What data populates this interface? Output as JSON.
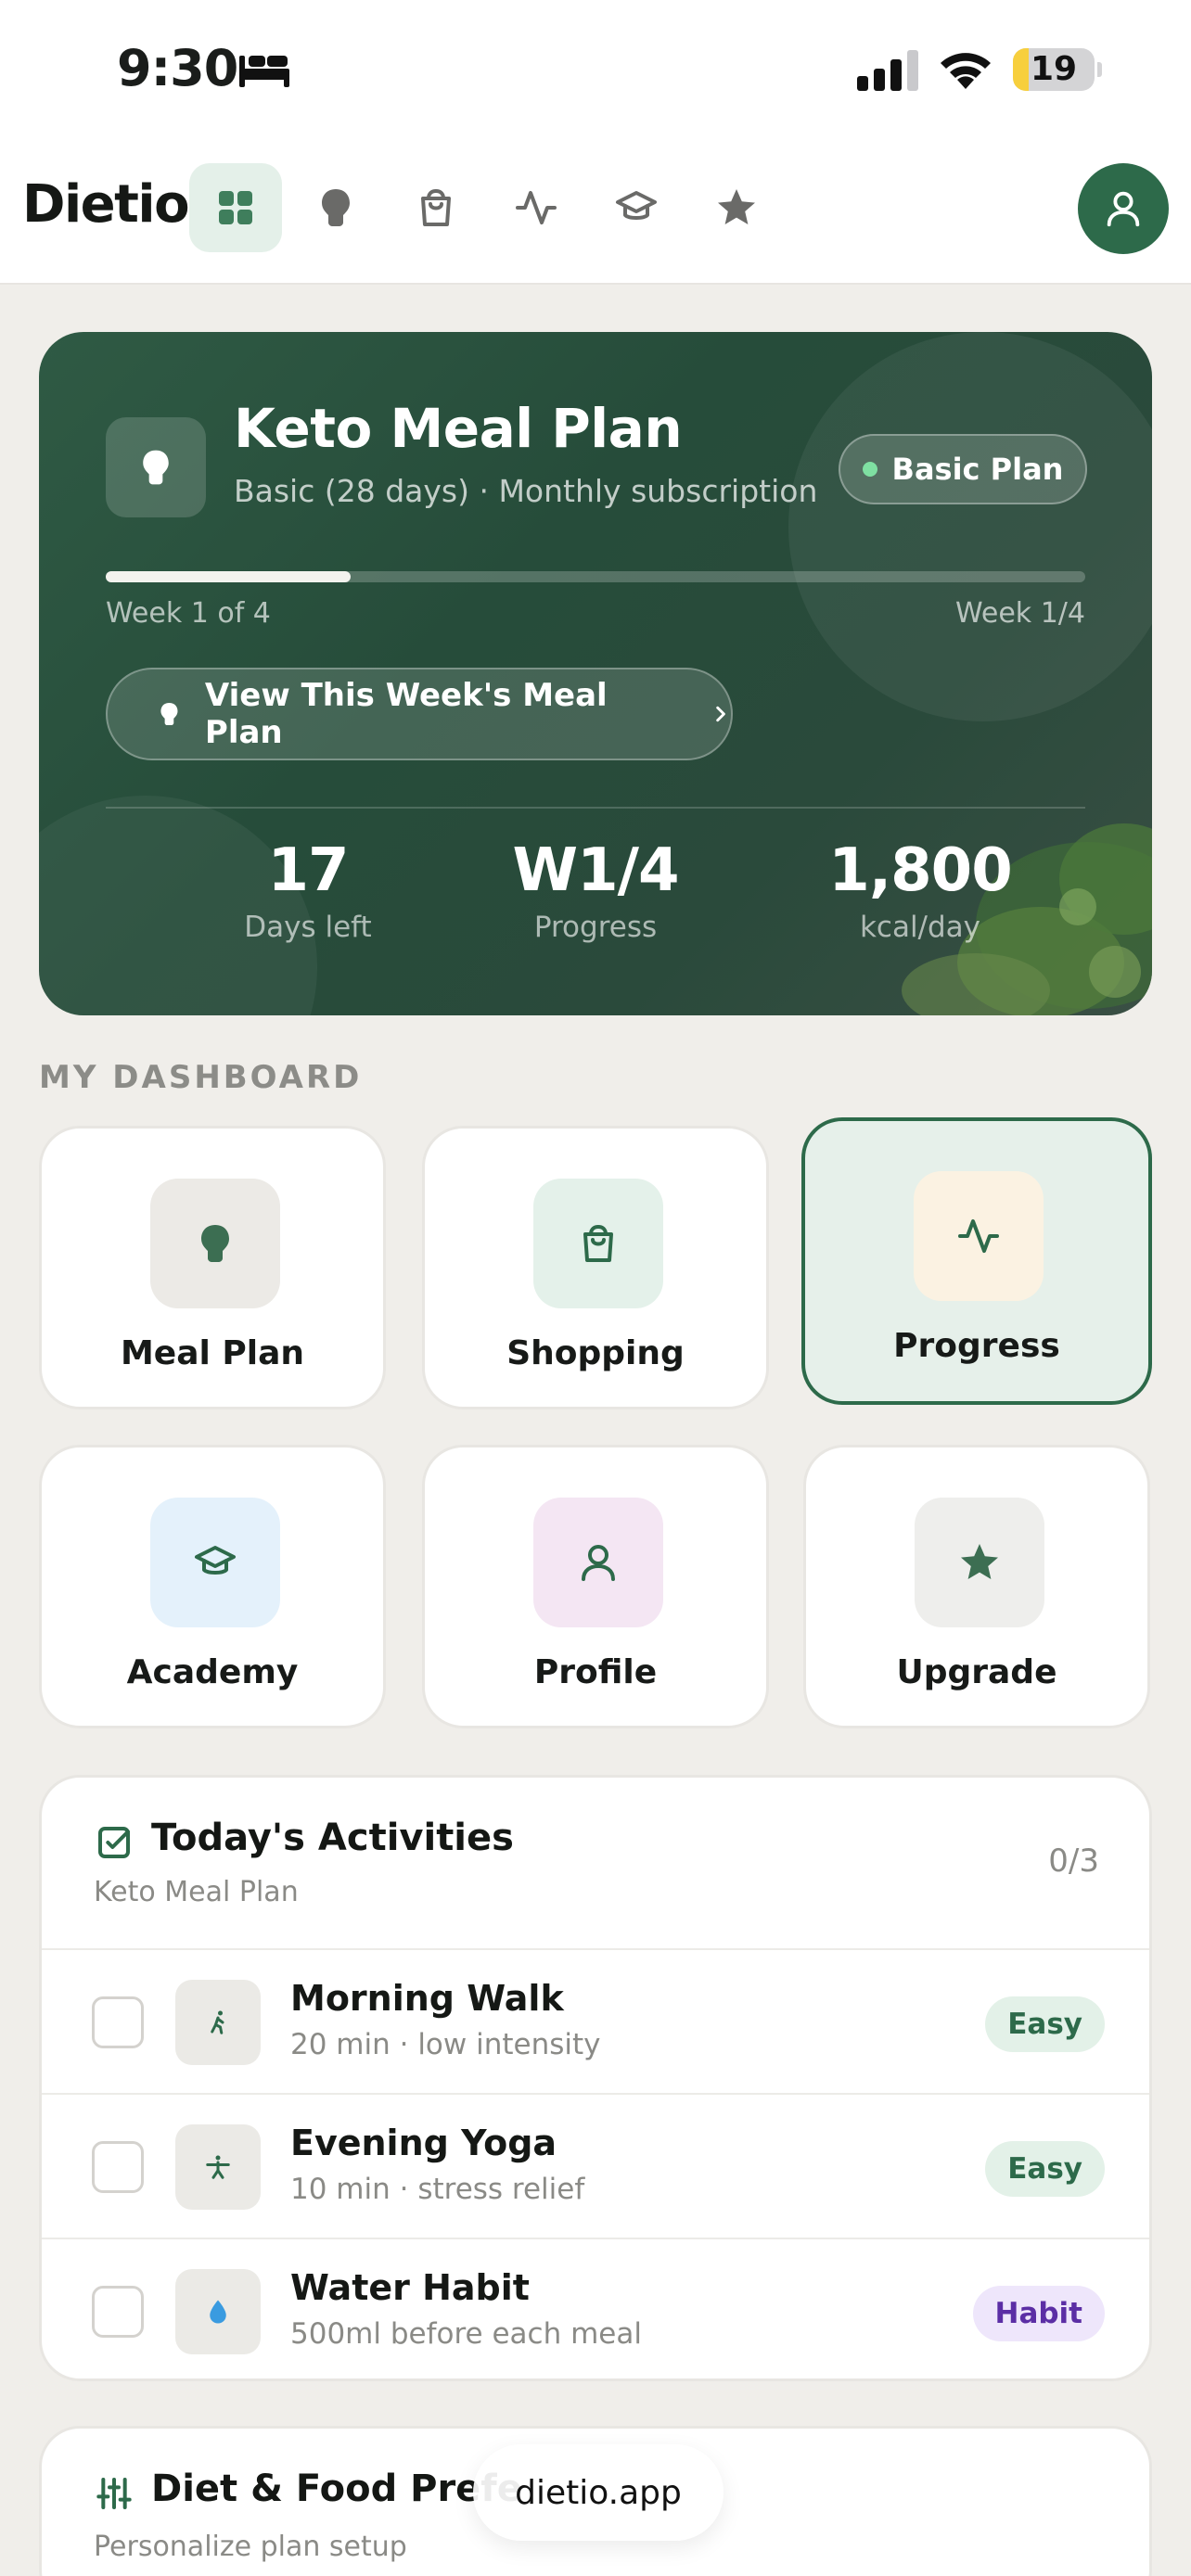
{
  "status_bar": {
    "time": "9:30",
    "battery_level": "19",
    "battery_fraction": 0.19,
    "icons": [
      "bed-icon",
      "signal-icon",
      "wifi-icon",
      "battery-icon"
    ]
  },
  "nav": {
    "logo": "Dietio",
    "items": [
      {
        "icon": "grid-icon",
        "active": true
      },
      {
        "icon": "bulb-icon",
        "active": false
      },
      {
        "icon": "bag-icon",
        "active": false
      },
      {
        "icon": "activity-icon",
        "active": false
      },
      {
        "icon": "graduation-cap-icon",
        "active": false
      },
      {
        "icon": "star-icon",
        "active": false
      }
    ],
    "avatar_icon": "user-icon"
  },
  "hero": {
    "title": "Keto Meal Plan",
    "subtitle": "Basic (28 days) · Monthly subscription",
    "badge": "Basic Plan",
    "progress_fraction": 0.25,
    "week_left": "Week 1 of 4",
    "week_right": "Week 1/4",
    "cta": "View This Week's Meal Plan",
    "stats": [
      {
        "value": "17",
        "label": "Days left"
      },
      {
        "value": "W1/4",
        "label": "Progress"
      },
      {
        "value": "1,800",
        "label": "kcal/day"
      }
    ]
  },
  "dashboard": {
    "section_title": "MY DASHBOARD",
    "tiles": [
      {
        "label": "Meal Plan",
        "icon": "bulb-icon",
        "bg": "#eceae6",
        "selected": false
      },
      {
        "label": "Shopping",
        "icon": "bag-icon",
        "bg": "#e4f1ea",
        "selected": false
      },
      {
        "label": "Progress",
        "icon": "activity-icon",
        "bg": "#fbf2e2",
        "selected": true
      },
      {
        "label": "Academy",
        "icon": "graduation-cap-icon",
        "bg": "#e4f1fb",
        "selected": false
      },
      {
        "label": "Profile",
        "icon": "user-icon",
        "bg": "#f4e6f3",
        "selected": false
      },
      {
        "label": "Upgrade",
        "icon": "star-icon",
        "bg": "#eeeeec",
        "selected": false
      }
    ]
  },
  "activities": {
    "title": "Today's Activities",
    "subtitle": "Keto Meal Plan",
    "count": "0/3",
    "items": [
      {
        "title": "Morning Walk",
        "sub": "20 min · low intensity",
        "tag": "Easy",
        "icon": "walk-icon"
      },
      {
        "title": "Evening Yoga",
        "sub": "10 min · stress relief",
        "tag": "Easy",
        "icon": "yoga-icon"
      },
      {
        "title": "Water Habit",
        "sub": "500ml before each meal",
        "tag": "Habit",
        "icon": "water-drop-icon"
      }
    ]
  },
  "preferences": {
    "title": "Diet & Food Prefe",
    "subtitle": "Personalize plan setup"
  },
  "browser": {
    "url": "dietio.app"
  },
  "colors": {
    "brand_green": "#2d6a4a",
    "background": "#f0eeea"
  }
}
